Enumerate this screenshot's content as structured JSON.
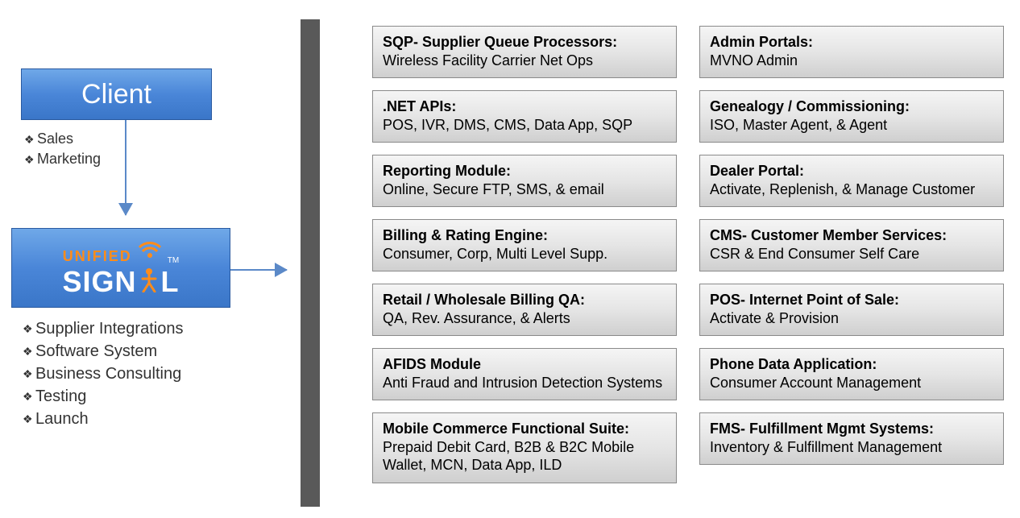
{
  "client": {
    "title": "Client",
    "bullets": [
      "Sales",
      "Marketing"
    ]
  },
  "signal": {
    "brand_top": "UNIFIED",
    "brand_main_left": "SIGN",
    "brand_main_right": "L",
    "bullets": [
      "Supplier Integrations",
      "Software System",
      "Business Consulting",
      "Testing",
      "Launch"
    ]
  },
  "modules_left": [
    {
      "title": "SQP- Supplier Queue Processors:",
      "desc": "Wireless Facility Carrier Net Ops"
    },
    {
      "title": ".NET APIs:",
      "desc": "POS, IVR, DMS, CMS, Data App, SQP"
    },
    {
      "title": "Reporting Module:",
      "desc": "Online, Secure FTP, SMS, & email"
    },
    {
      "title": "Billing & Rating Engine:",
      "desc": "Consumer, Corp, Multi Level Supp."
    },
    {
      "title": "Retail / Wholesale Billing  QA:",
      "desc": "QA, Rev. Assurance, & Alerts"
    },
    {
      "title": "AFIDS Module",
      "desc": "Anti Fraud and Intrusion Detection Systems"
    },
    {
      "title": "Mobile Commerce Functional Suite:",
      "desc": "Prepaid Debit Card, B2B & B2C Mobile Wallet, MCN, Data App, ILD"
    }
  ],
  "modules_right": [
    {
      "title": "Admin Portals:",
      "desc": "MVNO Admin"
    },
    {
      "title": "Genealogy / Commissioning:",
      "desc": "ISO, Master Agent, & Agent"
    },
    {
      "title": "Dealer Portal:",
      "desc": "Activate, Replenish, & Manage Customer"
    },
    {
      "title": "CMS- Customer Member Services:",
      "desc": "CSR & End Consumer Self Care"
    },
    {
      "title": "POS- Internet Point of Sale:",
      "desc": "Activate & Provision"
    },
    {
      "title": "Phone Data Application:",
      "desc": "Consumer Account Management"
    },
    {
      "title": "FMS- Fulfillment Mgmt Systems:",
      "desc": "Inventory & Fulfillment Management"
    }
  ]
}
